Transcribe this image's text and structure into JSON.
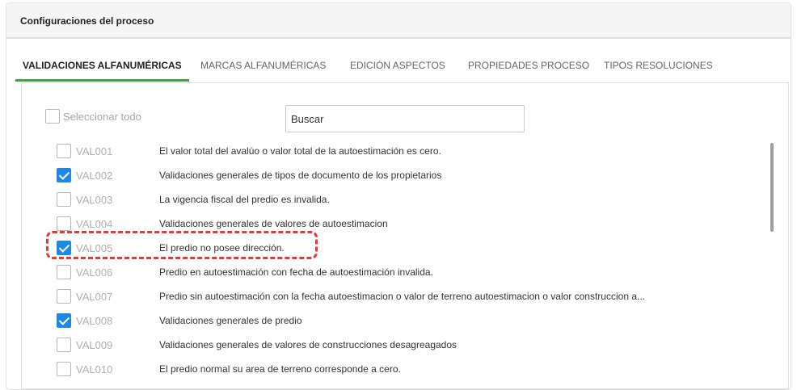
{
  "header": {
    "title": "Configuraciones del proceso"
  },
  "tabs": [
    {
      "label": "VALIDACIONES ALFANUMÉRICAS",
      "active": true
    },
    {
      "label": "MARCAS ALFANUMÉRICAS",
      "active": false
    },
    {
      "label": "EDICIÓN ASPECTOS",
      "active": false
    },
    {
      "label": "PROPIEDADES PROCESO",
      "active": false
    },
    {
      "label": "TIPOS RESOLUCIONES",
      "active": false
    }
  ],
  "panel": {
    "select_all_label": "Seleccionar todo",
    "search_value": "Buscar"
  },
  "rows": [
    {
      "code": "VAL001",
      "description": "El valor total del avalúo o valor total de la autoestimación es cero.",
      "checked": false
    },
    {
      "code": "VAL002",
      "description": "Validaciones generales de tipos de documento de los propietarios",
      "checked": true
    },
    {
      "code": "VAL003",
      "description": "La vigencia fiscal del predio es invalida.",
      "checked": false
    },
    {
      "code": "VAL004",
      "description": "Validaciones generales de valores de autoestimacion",
      "checked": false
    },
    {
      "code": "VAL005",
      "description": "El predio no posee dirección.",
      "checked": true
    },
    {
      "code": "VAL006",
      "description": "Predio en autoestimación con fecha de autoestimación invalida.",
      "checked": false
    },
    {
      "code": "VAL007",
      "description": "Predio sin autoestimación con la fecha autoestimacion o valor de terreno autoestimacion o valor construccion a...",
      "checked": false
    },
    {
      "code": "VAL008",
      "description": "Validaciones generales de predio",
      "checked": true
    },
    {
      "code": "VAL009",
      "description": "Validaciones generales de valores de construcciones desagreagados",
      "checked": false
    },
    {
      "code": "VAL010",
      "description": "El predio normal su area de terreno corresponde a cero.",
      "checked": false
    }
  ],
  "colors": {
    "active_tab_underline": "#43a047",
    "checkbox_checked": "#1e88e5",
    "highlight_annotation": "#e53935"
  }
}
